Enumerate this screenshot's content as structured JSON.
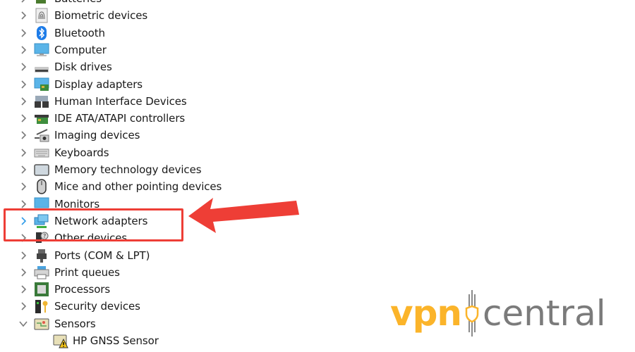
{
  "device_tree": {
    "items": [
      {
        "label": "Batteries",
        "icon": "battery-icon",
        "expanded": false
      },
      {
        "label": "Biometric devices",
        "icon": "fingerprint-icon",
        "expanded": false
      },
      {
        "label": "Bluetooth",
        "icon": "bluetooth-icon",
        "expanded": false
      },
      {
        "label": "Computer",
        "icon": "computer-monitor-icon",
        "expanded": false
      },
      {
        "label": "Disk drives",
        "icon": "disk-drive-icon",
        "expanded": false
      },
      {
        "label": "Display adapters",
        "icon": "display-adapter-icon",
        "expanded": false
      },
      {
        "label": "Human Interface Devices",
        "icon": "hid-icon",
        "expanded": false
      },
      {
        "label": "IDE ATA/ATAPI controllers",
        "icon": "ide-controller-icon",
        "expanded": false
      },
      {
        "label": "Imaging devices",
        "icon": "camera-icon",
        "expanded": false
      },
      {
        "label": "Keyboards",
        "icon": "keyboard-icon",
        "expanded": false
      },
      {
        "label": "Memory technology devices",
        "icon": "memory-device-icon",
        "expanded": false
      },
      {
        "label": "Mice and other pointing devices",
        "icon": "mouse-icon",
        "expanded": false
      },
      {
        "label": "Monitors",
        "icon": "monitor-icon",
        "expanded": false
      },
      {
        "label": "Network adapters",
        "icon": "network-adapter-icon",
        "expanded": false,
        "highlighted": true
      },
      {
        "label": "Other devices",
        "icon": "unknown-device-icon",
        "expanded": false
      },
      {
        "label": "Ports (COM & LPT)",
        "icon": "port-icon",
        "expanded": false
      },
      {
        "label": "Print queues",
        "icon": "printer-icon",
        "expanded": false
      },
      {
        "label": "Processors",
        "icon": "processor-icon",
        "expanded": false
      },
      {
        "label": "Security devices",
        "icon": "security-device-icon",
        "expanded": false
      },
      {
        "label": "Sensors",
        "icon": "sensor-icon",
        "expanded": true
      }
    ],
    "sensor_children": [
      {
        "label": "HP GNSS Sensor",
        "icon": "sensor-warning-icon",
        "status": "warning"
      }
    ]
  },
  "annotation": {
    "highlight_target": "Network adapters",
    "color": "#ee3e36"
  },
  "logo": {
    "part1": "vpn",
    "part2": "central",
    "color_primary": "#fbb42a",
    "color_secondary": "#7b7b7b"
  }
}
